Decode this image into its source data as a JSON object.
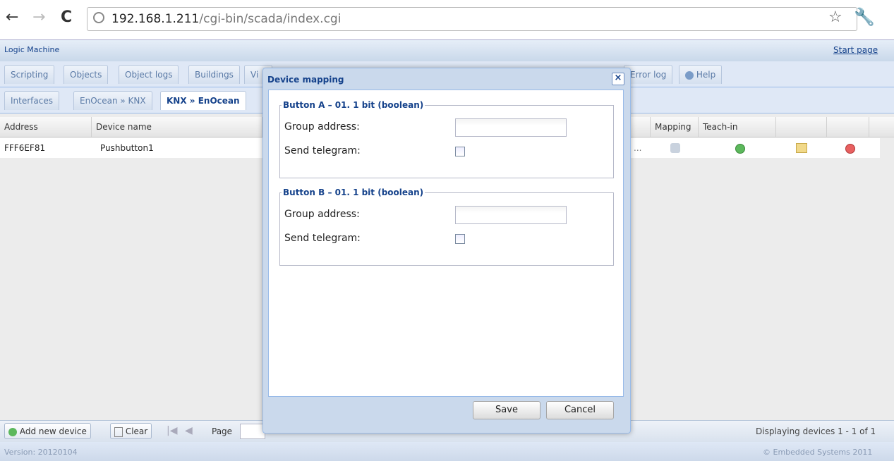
{
  "browser": {
    "url_host": "192.168.1.211",
    "url_path": "/cgi-bin/scada/index.cgi",
    "back_icon": "←",
    "forward_icon": "→",
    "reload_icon": "C",
    "star_icon": "☆",
    "wrench_icon": "🔧"
  },
  "app": {
    "title": "Logic Machine",
    "start_page": "Start page"
  },
  "main_tabs": [
    "Scripting",
    "Objects",
    "Object logs",
    "Buildings",
    "Vi",
    "Error log",
    "Help"
  ],
  "sub_tabs": [
    "Interfaces",
    "EnOcean » KNX",
    "KNX » EnOcean"
  ],
  "grid": {
    "columns": [
      "Address",
      "Device name",
      "Mapping",
      "Teach-in"
    ],
    "row": {
      "address": "FFF6EF81",
      "device_name": "Pushbutton1",
      "ellipsis": "..."
    }
  },
  "toolbar": {
    "add_label": "Add new device",
    "clear_label": "Clear",
    "page_label": "Page",
    "display_text": "Displaying devices 1 - 1 of 1"
  },
  "status": {
    "version": "Version: 20120104",
    "copyright": "© Embedded Systems 2011"
  },
  "dialog": {
    "title": "Device mapping",
    "close_icon": "×",
    "fieldsets": [
      {
        "legend": "Button A – 01. 1 bit (boolean)",
        "group_label": "Group address:",
        "group_value": "",
        "send_label": "Send telegram:"
      },
      {
        "legend": "Button B – 01. 1 bit (boolean)",
        "group_label": "Group address:",
        "group_value": "",
        "send_label": "Send telegram:"
      }
    ],
    "save_label": "Save",
    "cancel_label": "Cancel"
  },
  "colors": {
    "accent": "#15428b",
    "header_bg": "#dfe8f6"
  }
}
